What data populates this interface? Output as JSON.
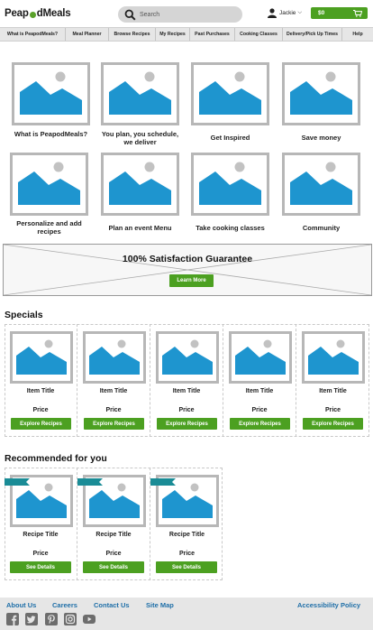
{
  "header": {
    "logo_prefix": "Peap",
    "logo_suffix": "dMeals",
    "search_placeholder": "Search",
    "user_name": "Jackie",
    "cart_amount": "$0"
  },
  "nav": [
    "What is PeapodMeals?",
    "Meal Planner",
    "Browse Recipes",
    "My Recipes",
    "Past Purchases",
    "Cooking Classes",
    "Delivery/Pick Up Times",
    "Help"
  ],
  "features": [
    "What is PeapodMeals?",
    "You plan, you schedule, we deliver",
    "Get Inspired",
    "Save money",
    "Personalize and add recipes",
    "Plan an event Menu",
    "Take cooking classes",
    "Community"
  ],
  "banner": {
    "title": "100% Satisfaction Guarantee",
    "button": "Learn More"
  },
  "specials": {
    "title": "Specials",
    "items": [
      {
        "title": "Item Title",
        "price": "Price",
        "button": "Explore Recipes"
      },
      {
        "title": "Item Title",
        "price": "Price",
        "button": "Explore Recipes"
      },
      {
        "title": "Item Title",
        "price": "Price",
        "button": "Explore Recipes"
      },
      {
        "title": "Item Title",
        "price": "Price",
        "button": "Explore Recipes"
      },
      {
        "title": "Item Title",
        "price": "Price",
        "button": "Explore Recipes"
      }
    ]
  },
  "recommended": {
    "title": "Recommended for you",
    "items": [
      {
        "title": "Recipe Title",
        "price": "Price",
        "button": "See Details"
      },
      {
        "title": "Recipe Title",
        "price": "Price",
        "button": "See Details"
      },
      {
        "title": "Recipe Title",
        "price": "Price",
        "button": "See Details"
      }
    ]
  },
  "footer": {
    "links": [
      "About Us",
      "Careers",
      "Contact Us",
      "Site Map"
    ],
    "accessibility": "Accessibility Policy",
    "social": [
      "facebook-icon",
      "twitter-icon",
      "pinterest-icon",
      "instagram-icon",
      "youtube-icon"
    ]
  },
  "colors": {
    "accent_green": "#4ca021",
    "image_blue": "#1e95cf",
    "link_blue": "#1f6fa8"
  }
}
